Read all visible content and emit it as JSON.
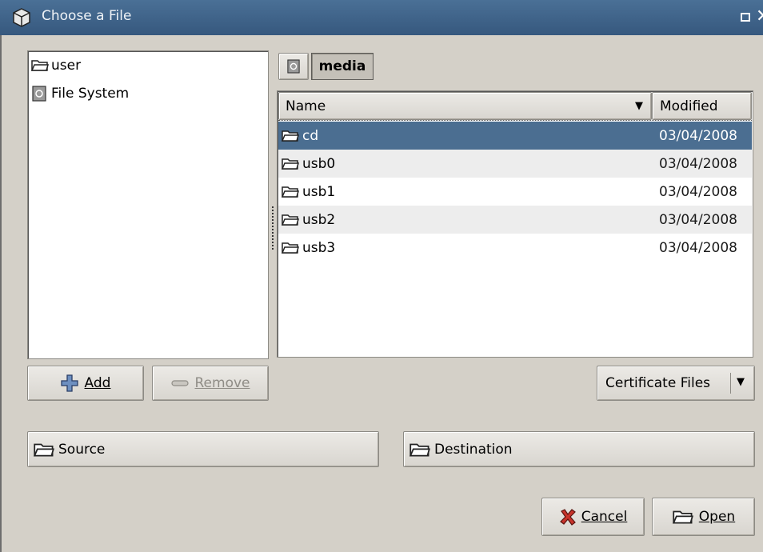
{
  "window": {
    "title": "Choose a File"
  },
  "places": [
    {
      "label": "user",
      "icon": "folder-icon"
    },
    {
      "label": "File System",
      "icon": "drive-icon"
    }
  ],
  "path_bar": {
    "current": "media"
  },
  "file_list": {
    "columns": {
      "name": "Name",
      "modified": "Modified"
    },
    "rows": [
      {
        "name": "cd",
        "modified": "03/04/2008",
        "selected": true
      },
      {
        "name": "usb0",
        "modified": "03/04/2008"
      },
      {
        "name": "usb1",
        "modified": "03/04/2008"
      },
      {
        "name": "usb2",
        "modified": "03/04/2008"
      },
      {
        "name": "usb3",
        "modified": "03/04/2008"
      }
    ]
  },
  "buttons": {
    "add_label": "Add",
    "remove_label": "Remove",
    "filter_value": "Certificate Files",
    "source_label": "Source",
    "destination_label": "Destination",
    "cancel_label": "Cancel",
    "open_label": "Open"
  },
  "colors": {
    "selection": "#4b6e91",
    "titlebar": "#3d6087"
  }
}
